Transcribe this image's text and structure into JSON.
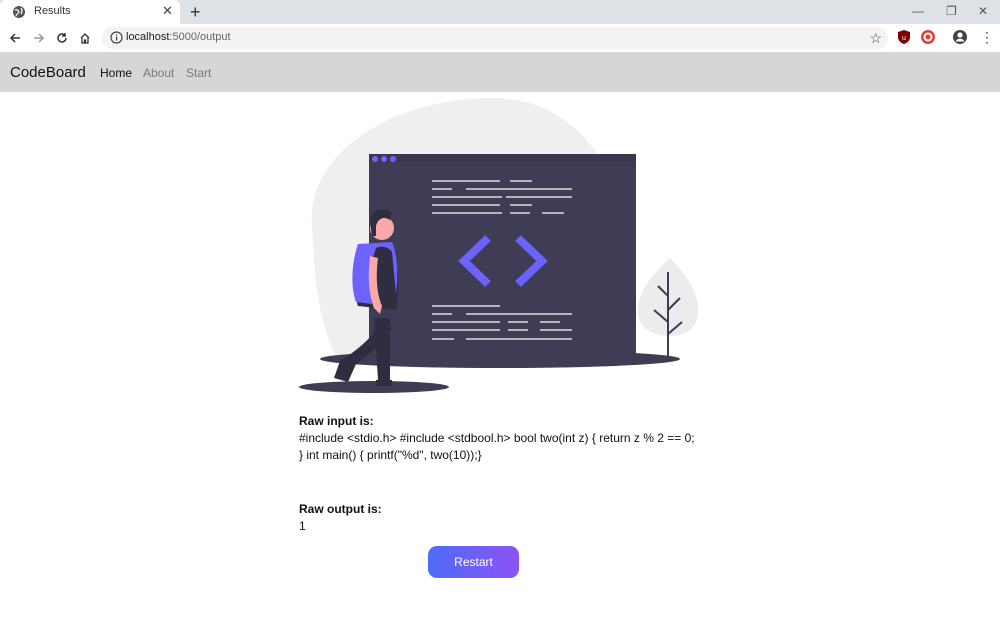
{
  "browser": {
    "tab_title": "Results",
    "url_host": "localhost",
    "url_rest": ":5000/output"
  },
  "navbar": {
    "brand": "CodeBoard",
    "links": [
      {
        "label": "Home",
        "active": true
      },
      {
        "label": "About",
        "active": false
      },
      {
        "label": "Start",
        "active": false
      }
    ]
  },
  "result": {
    "input_label": "Raw input is:",
    "input_text": "#include <stdio.h> #include <stdbool.h> bool two(int z) { return z % 2 == 0; } int main() { printf(\"%d\", two(10));}",
    "output_label": "Raw output is:",
    "output_text": "1",
    "restart_label": "Restart"
  },
  "colors": {
    "accent_start": "#4f6cf7",
    "accent_end": "#8b53f6",
    "navbar_bg": "#d6d6d6",
    "illustration_purple": "#6c63ff",
    "illustration_dark": "#3f3d56"
  },
  "icons": [
    "globe-icon",
    "close-icon",
    "plus-icon",
    "back-arrow-icon",
    "forward-arrow-icon",
    "reload-icon",
    "home-icon",
    "info-icon",
    "star-icon",
    "ublock-icon",
    "target-icon",
    "account-icon",
    "kebab-menu-icon"
  ]
}
